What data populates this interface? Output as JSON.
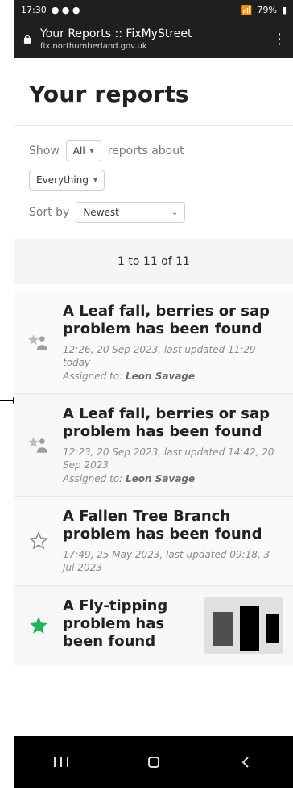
{
  "status": {
    "time": "17:30",
    "battery": "79%"
  },
  "browser": {
    "title": "Your Reports :: FixMyStreet",
    "url": "fix.northumberland.gov.uk"
  },
  "page": {
    "title": "Your reports",
    "filters": {
      "show_label": "Show",
      "show_value": "All",
      "reports_about_label": "reports about",
      "category_value": "Everything",
      "sort_label": "Sort by",
      "sort_value": "Newest"
    },
    "summary": "1 to 11 of 11"
  },
  "reports": [
    {
      "title": "A Leaf fall, berries or sap problem has been found",
      "meta": "12:26, 20 Sep 2023, last updated 11:29 today",
      "assigned_label": "Assigned to:",
      "assignee": "Leon Savage"
    },
    {
      "title": "A Leaf fall, berries or sap problem has been found",
      "meta": "12:23, 20 Sep 2023, last updated 14:42, 20 Sep 2023",
      "assigned_label": "Assigned to:",
      "assignee": "Leon Savage"
    },
    {
      "title": "A Fallen Tree Branch problem has been found",
      "meta": "17:49, 25 May 2023, last updated 09:18, 3 Jul 2023"
    },
    {
      "title": "A Fly-tipping problem has been found"
    }
  ],
  "colors": {
    "green_star": "#1db45a",
    "outline_star": "#8c8c8c",
    "dark_bar": "#1f1f1f"
  },
  "icons": {
    "lock": "lock-icon",
    "menu": "kebab-menu-icon",
    "star_outline": "star-outline-icon",
    "star_green": "star-filled-icon",
    "person_badge": "person-star-icon"
  }
}
